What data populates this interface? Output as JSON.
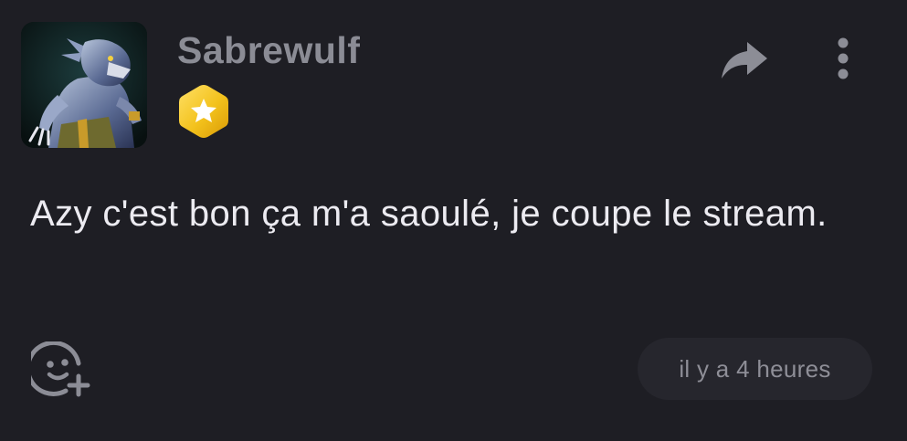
{
  "post": {
    "author": {
      "username": "Sabrewulf",
      "avatar_alt": "Sabrewulf avatar",
      "badge_icon": "star-hexagon-badge-icon"
    },
    "actions": {
      "share_icon": "share-arrow-icon",
      "more_icon": "vertical-dots-icon",
      "react_icon": "add-reaction-icon"
    },
    "message": "Azy c'est bon ça m'a saoulé, je coupe le stream.",
    "timestamp": "il y a 4 heures"
  },
  "colors": {
    "background": "#1e1e24",
    "username": "#8b8c95",
    "message_text": "#ecebf1",
    "icon": "#8c8d96",
    "timestamp_bg": "#26262d",
    "badge_gold": "#f3c21c"
  }
}
